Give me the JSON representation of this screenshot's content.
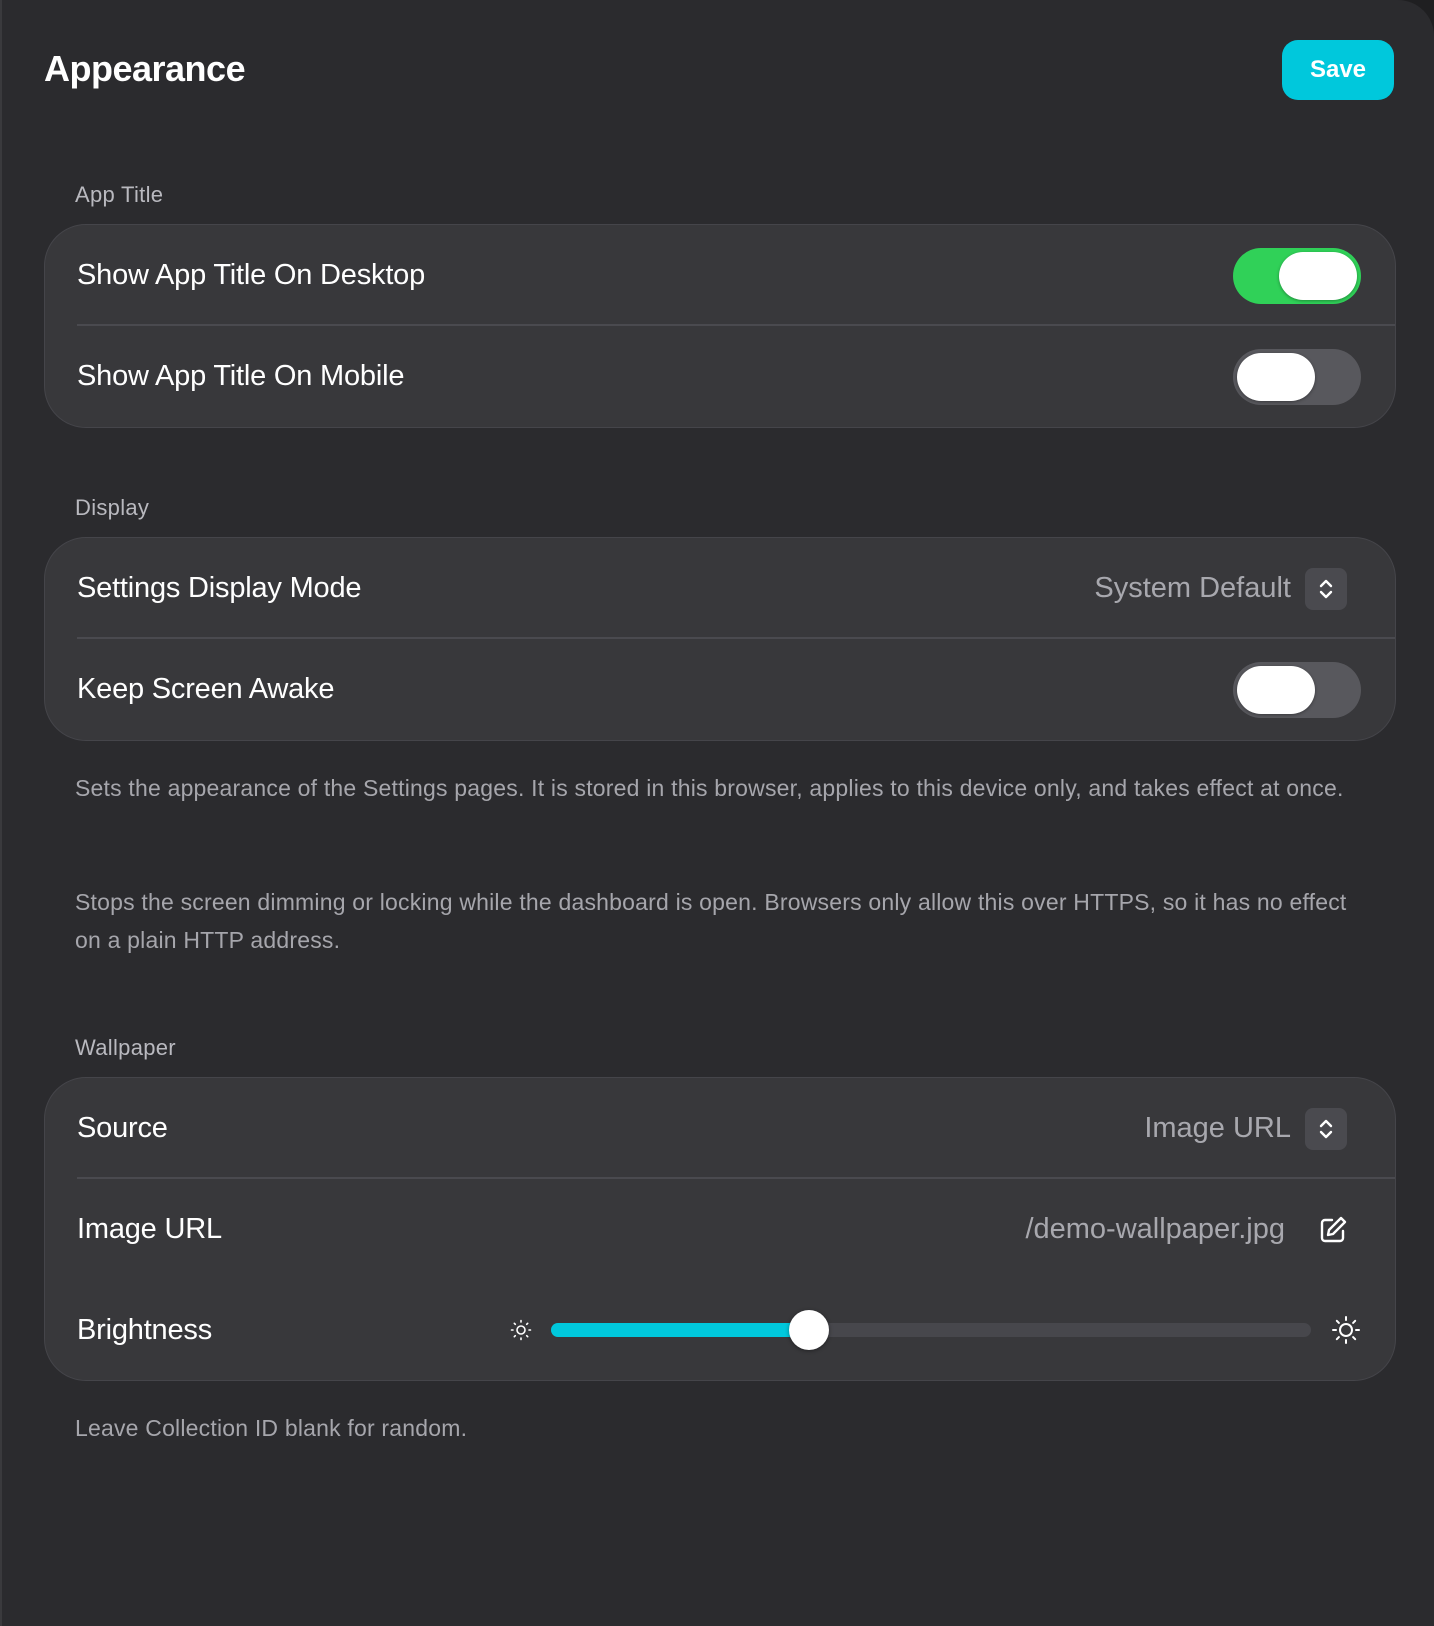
{
  "header": {
    "title": "Appearance",
    "save_label": "Save"
  },
  "sections": {
    "app_title": {
      "label": "App Title",
      "rows": {
        "desktop": {
          "label": "Show App Title On Desktop",
          "enabled": true
        },
        "mobile": {
          "label": "Show App Title On Mobile",
          "enabled": false
        }
      }
    },
    "display": {
      "label": "Display",
      "rows": {
        "mode": {
          "label": "Settings Display Mode",
          "value": "System Default",
          "icon": "chevron-up-down-icon"
        },
        "awake": {
          "label": "Keep Screen Awake",
          "enabled": false
        }
      },
      "help": [
        "Sets the appearance of the Settings pages. It is stored in this browser, applies to this device only, and takes effect at once.",
        "Stops the screen dimming or locking while the dashboard is open. Browsers only allow this over HTTPS, so it has no effect on a plain HTTP address."
      ]
    },
    "wallpaper": {
      "label": "Wallpaper",
      "rows": {
        "source": {
          "label": "Source",
          "value": "Image URL",
          "icon": "chevron-up-down-icon"
        },
        "image_url": {
          "label": "Image URL",
          "value": "/demo-wallpaper.jpg",
          "icon": "edit-icon"
        },
        "brightness": {
          "label": "Brightness",
          "value_fraction": 0.34,
          "min_icon": "sun-small-icon",
          "max_icon": "sun-large-icon"
        }
      },
      "help": "Leave Collection ID blank for random."
    }
  },
  "colors": {
    "accent": "#00c8dc",
    "toggle_on": "#30d158",
    "toggle_off": "#58585d",
    "panel_bg": "#2b2b2e",
    "group_bg": "#38383b"
  }
}
